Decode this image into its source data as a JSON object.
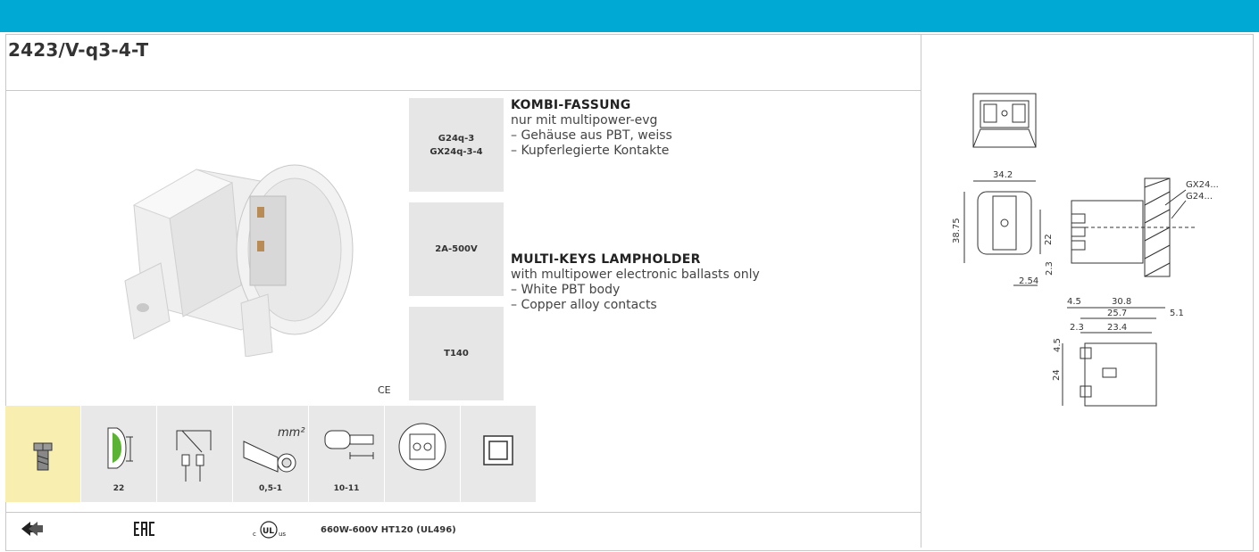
{
  "header": {
    "accent_color": "#00a9d4"
  },
  "product": {
    "code": "2423/V-q3-4-T"
  },
  "specs": {
    "socket": "G24q-3\nGX24q-3-4",
    "rating": "2A-500V",
    "temperature": "T140"
  },
  "description_de": {
    "heading": "KOMBI-FASSUNG",
    "subtitle": "nur mit multipower-evg",
    "line1": "– Gehäuse aus PBT, weiss",
    "line2": "– Kupferlegierte Kontakte"
  },
  "description_en": {
    "heading": "MULTI-KEYS LAMPHOLDER",
    "subtitle": "with multipower electronic ballasts only",
    "line1": "– White PBT body",
    "line2": "– Copper alloy contacts"
  },
  "ce_mark": "CE",
  "icons": [
    {
      "icon": "screw-fixing-icon",
      "label": ""
    },
    {
      "icon": "panel-thickness-icon",
      "label": "22"
    },
    {
      "icon": "push-wire-terminal-icon",
      "label": ""
    },
    {
      "icon": "wire-cross-section-icon",
      "label": "0,5-1"
    },
    {
      "icon": "strip-length-icon",
      "label": "10-11"
    },
    {
      "icon": "lamp-base-icon",
      "label": ""
    },
    {
      "icon": "double-insulation-icon",
      "label": ""
    }
  ],
  "footer": {
    "certification_1": "ENEC",
    "certification_2": "EAC",
    "certification_3": "cULus",
    "ul_rating": "660W-600V HT120 (UL496)"
  },
  "drawing": {
    "width_dim": "34.2",
    "height_dim": "38.75",
    "dim_22": "22",
    "dim_2_54": "2.54",
    "dim_2_3": "2.3",
    "label_gx24": "GX24...",
    "label_g24": "G24...",
    "dim_4_5": "4.5",
    "dim_30_8": "30.8",
    "dim_25_7": "25.7",
    "dim_5_1": "5.1",
    "dim_2_3b": "2.3",
    "dim_23_4": "23.4",
    "dim_4_5b": "4.5",
    "dim_24": "24"
  }
}
